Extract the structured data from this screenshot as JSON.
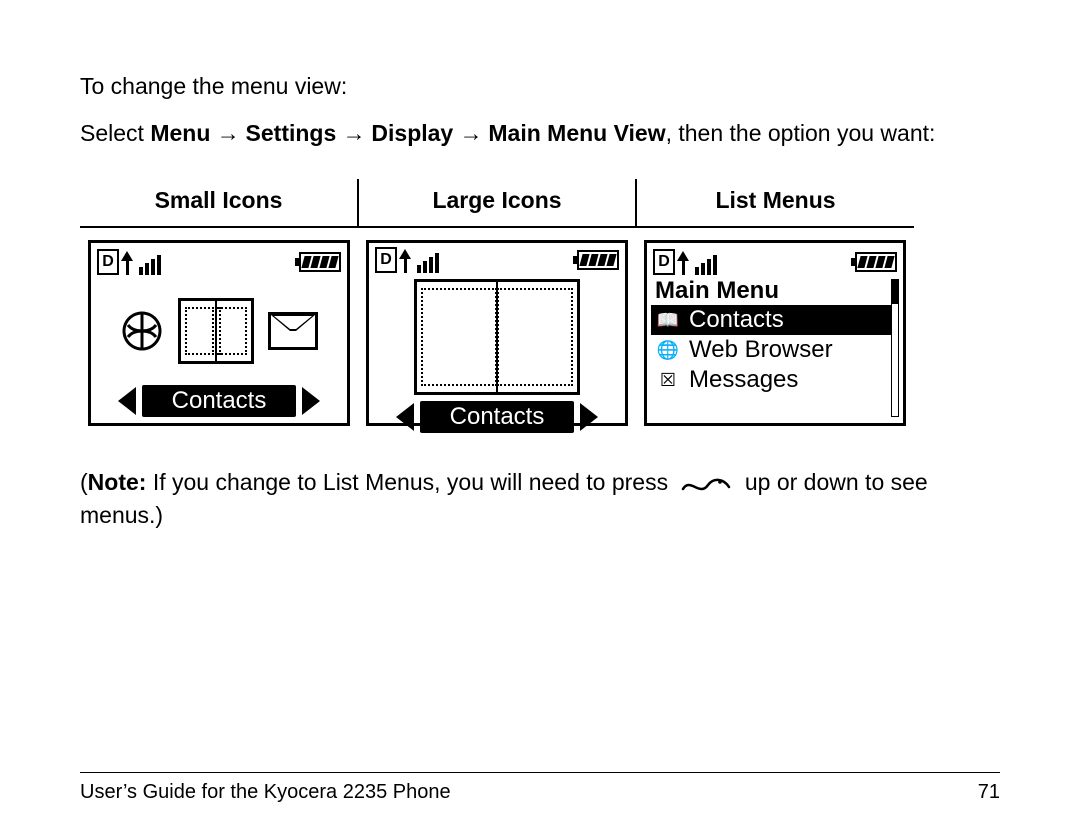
{
  "intro": "To change the menu view:",
  "path": {
    "prefix": "Select ",
    "steps": [
      "Menu",
      "Settings",
      "Display",
      "Main Menu View"
    ],
    "suffix": ", then the option you want:"
  },
  "columns": {
    "small": "Small Icons",
    "large": "Large Icons",
    "list": "List Menus"
  },
  "status": {
    "mode_letter": "D"
  },
  "screens": {
    "small": {
      "selected_label": "Contacts",
      "icons": [
        "web-browser-icon",
        "contacts-book-icon",
        "messages-envelope-icon"
      ]
    },
    "large": {
      "selected_label": "Contacts",
      "icon": "contacts-book-icon"
    },
    "list": {
      "title": "Main Menu",
      "items": [
        {
          "label": "Contacts",
          "icon": "contacts-book-icon",
          "selected": true
        },
        {
          "label": "Web Browser",
          "icon": "web-browser-icon",
          "selected": false
        },
        {
          "label": "Messages",
          "icon": "messages-envelope-icon",
          "selected": false
        }
      ]
    }
  },
  "note": {
    "prefix": "(",
    "label": "Note:",
    "text_before": " If you change to List Menus, you will need to press ",
    "text_after": " up or down to see menus.)"
  },
  "footer": {
    "title": "User’s Guide for the Kyocera 2235 Phone",
    "page": "71"
  }
}
